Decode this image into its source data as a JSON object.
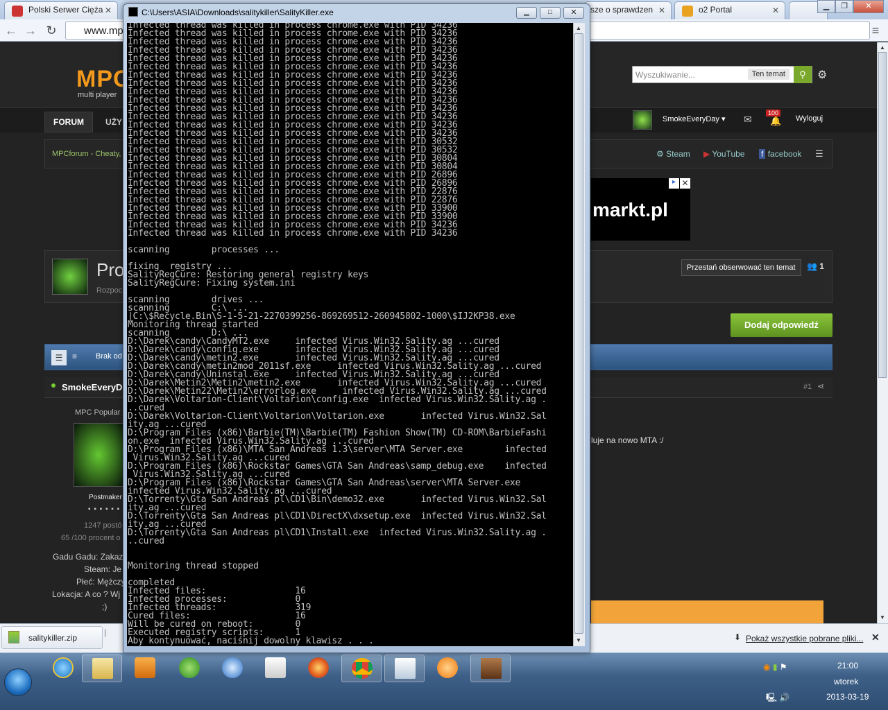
{
  "browser": {
    "tabs": [
      {
        "label": "Polski Serwer Cięża"
      },
      {
        "label": "sze o sprawdzen"
      },
      {
        "label": "o2 Portal"
      }
    ],
    "address": "www.mp",
    "navicons": [
      "back-icon",
      "forward-icon",
      "reload-icon",
      "star-icon",
      "menu-icon"
    ]
  },
  "site": {
    "logo": "MPC",
    "logo_sub": "multi player",
    "search_placeholder": "Wyszukiwanie...",
    "search_scope": "Ten temat",
    "nav": {
      "forum": "FORUM",
      "second": "UŻY"
    },
    "user": {
      "name": "SmokeEveryDay",
      "notifications": "100",
      "logout": "Wyloguj"
    },
    "breadcrumb": "MPCforum - Cheaty,",
    "social": {
      "steam": "Steam",
      "youtube": "YouTube",
      "facebook": "facebook"
    },
    "ad": {
      "text": "markt.pl"
    },
    "topic": {
      "title": "Pro",
      "subtitle": "Rozpoc",
      "unfollow": "Przestań obserwować ten temat",
      "followers": "1",
      "reply": "Dodaj odpowiedź"
    },
    "postbar_text": "Brak od",
    "post": {
      "author": "SmokeEveryD",
      "number": "#1",
      "rank": "MPC Popular U",
      "group": "Postmaker",
      "dots": "▪ ▪ ▪ ▪ ▪ ▪ ▪ ▪",
      "posts": "1247 postó",
      "percent": "65 /100 procent o",
      "gg": "Gadu Gadu: Zakaz",
      "steam": "Steam: Je",
      "gender": "Płeć: Mężczy",
      "location": "Lokacja: A co ? Wj",
      "smile": ";)",
      "text": "luje na nowo MTA :/"
    }
  },
  "downloads": {
    "file": "salitykiller.zip",
    "show_all": "Pokaż wszystkie pobrane pliki..."
  },
  "taskbar": {
    "icons": [
      "ie-icon",
      "explorer-icon",
      "media-player-icon",
      "utorrent-icon",
      "flash-icon",
      "calendar-321-icon",
      "firefox-icon",
      "chrome-icon",
      "window-icon",
      "avast-icon",
      "game-icon"
    ],
    "time": "21:00",
    "day": "wtorek",
    "date": "2013-03-19"
  },
  "console": {
    "title": "C:\\Users\\ASIA\\Downloads\\salitykiller\\SalityKiller.exe",
    "lines": [
      "Infected thread was killed in process chrome.exe with PID 34236",
      "Infected thread was killed in process chrome.exe with PID 34236",
      "Infected thread was killed in process chrome.exe with PID 34236",
      "Infected thread was killed in process chrome.exe with PID 34236",
      "Infected thread was killed in process chrome.exe with PID 34236",
      "Infected thread was killed in process chrome.exe with PID 34236",
      "Infected thread was killed in process chrome.exe with PID 34236",
      "Infected thread was killed in process chrome.exe with PID 34236",
      "Infected thread was killed in process chrome.exe with PID 34236",
      "Infected thread was killed in process chrome.exe with PID 34236",
      "Infected thread was killed in process chrome.exe with PID 34236",
      "Infected thread was killed in process chrome.exe with PID 34236",
      "Infected thread was killed in process chrome.exe with PID 34236",
      "Infected thread was killed in process chrome.exe with PID 34236",
      "Infected thread was killed in process chrome.exe with PID 30532",
      "Infected thread was killed in process chrome.exe with PID 30532",
      "Infected thread was killed in process chrome.exe with PID 30804",
      "Infected thread was killed in process chrome.exe with PID 30804",
      "Infected thread was killed in process chrome.exe with PID 26896",
      "Infected thread was killed in process chrome.exe with PID 26896",
      "Infected thread was killed in process chrome.exe with PID 22876",
      "Infected thread was killed in process chrome.exe with PID 22876",
      "Infected thread was killed in process chrome.exe with PID 33900",
      "Infected thread was killed in process chrome.exe with PID 33900",
      "Infected thread was killed in process chrome.exe with PID 34236",
      "Infected thread was killed in process chrome.exe with PID 34236",
      "",
      "scanning        processes ...",
      "",
      "fixing  registry ...",
      "SalityRegCure: Restoring general registry keys",
      "SalityRegCure: Fixing system.ini",
      "",
      "scanning        drives ...",
      "scanning        C:\\ ...",
      "|C:\\$Recycle.Bin\\S-1-5-21-2270399256-869269512-260945802-1000\\$IJ2KP38.exe",
      "Monitoring thread started",
      "scanning        D:\\ ...",
      "D:\\Darek\\candy\\CandyMT2.exe     infected Virus.Win32.Sality.ag ...cured",
      "D:\\Darek\\candy\\config.exe       infected Virus.Win32.Sality.ag ...cured",
      "D:\\Darek\\candy\\metin2.exe       infected Virus.Win32.Sality.ag ...cured",
      "D:\\Darek\\candy\\metin2mod_2011sf.exe     infected Virus.Win32.Sality.ag ...cured",
      "D:\\Darek\\candy\\Uninstal.exe     infected Virus.Win32.Sality.ag ...cured",
      "D:\\Darek\\Metin2\\Metin2\\metin2.exe       infected Virus.Win32.Sality.ag ...cured",
      "D:\\Darek\\Metin22\\Metin2\\errorlog.exe     infected Virus.Win32.Sality.ag ...cured",
      "D:\\Darek\\Voltarion-Client\\Voltarion\\config.exe  infected Virus.Win32.Sality.ag .",
      "..cured",
      "D:\\Darek\\Voltarion-Client\\Voltarion\\Voltarion.exe       infected Virus.Win32.Sal",
      "ity.ag ...cured",
      "D:\\Program Files (x86)\\Barbie(TM)\\Barbie(TM) Fashion Show(TM) CD-ROM\\BarbieFashi",
      "on.exe  infected Virus.Win32.Sality.ag ...cured",
      "D:\\Program Files (x86)\\MTA San Andreas 1.3\\server\\MTA Server.exe        infected",
      " Virus.Win32.Sality.ag ...cured",
      "D:\\Program Files (x86)\\Rockstar Games\\GTA San Andreas\\samp_debug.exe    infected",
      " Virus.Win32.Sality.ag ...cured",
      "D:\\Program Files (x86)\\Rockstar Games\\GTA San Andreas\\server\\MTA Server.exe",
      "infected Virus.Win32.Sality.ag ...cured",
      "D:\\Torrenty\\Gta San Andreas pl\\CD1\\Bin\\demo32.exe       infected Virus.Win32.Sal",
      "ity.ag ...cured",
      "D:\\Torrenty\\Gta San Andreas pl\\CD1\\DirectX\\dxsetup.exe  infected Virus.Win32.Sal",
      "ity.ag ...cured",
      "D:\\Torrenty\\Gta San Andreas pl\\CD1\\Install.exe  infected Virus.Win32.Sality.ag .",
      "..cured",
      "",
      "",
      "Monitoring thread stopped",
      "",
      "completed",
      "Infected files:                 16",
      "Infected processes:             0",
      "Infected threads:               319",
      "Cured files:                    16",
      "Will be cured on reboot:        0",
      "Executed registry scripts:      1",
      "Aby kontynuować, naciśnij dowolny klawisz . . ."
    ]
  }
}
